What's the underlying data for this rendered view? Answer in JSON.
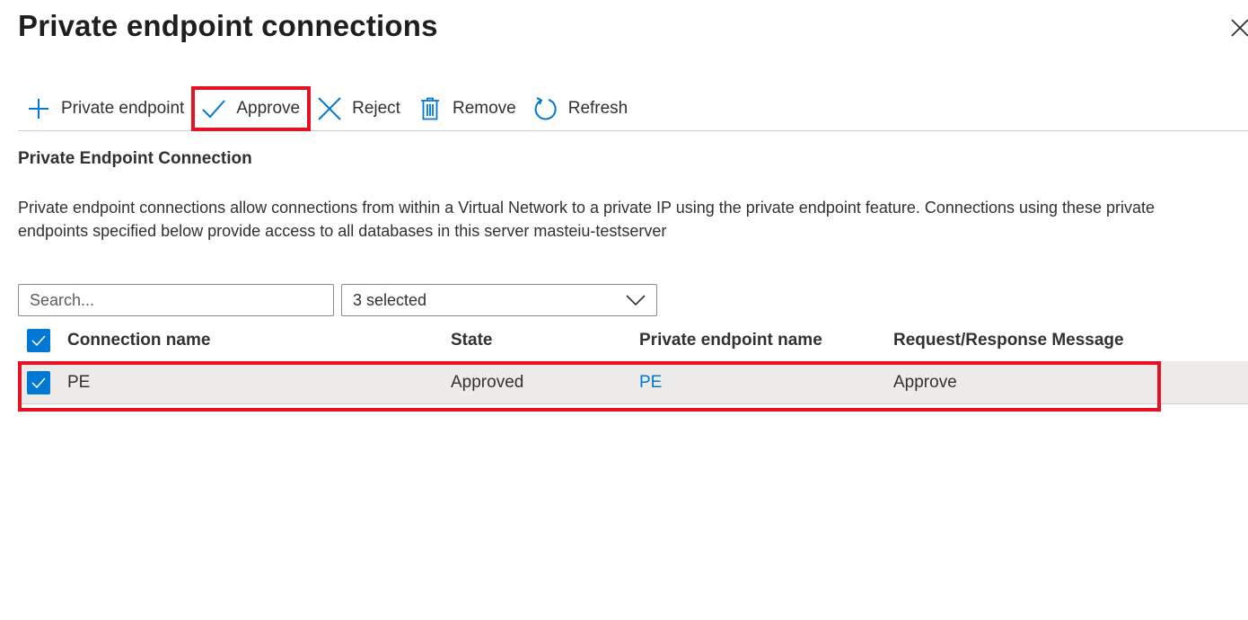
{
  "page": {
    "title": "Private endpoint connections",
    "close_icon": "close-icon"
  },
  "toolbar": {
    "items": [
      {
        "label": "Private endpoint",
        "icon": "plus-icon"
      },
      {
        "label": "Approve",
        "icon": "checkmark-icon",
        "highlighted": true
      },
      {
        "label": "Reject",
        "icon": "x-icon"
      },
      {
        "label": "Remove",
        "icon": "trash-icon"
      },
      {
        "label": "Refresh",
        "icon": "refresh-icon"
      }
    ]
  },
  "section": {
    "title": "Private Endpoint Connection",
    "description_line1": "Private endpoint connections allow connections from within a Virtual Network to a private IP using the private endpoint feature. Connections using these private",
    "description_line2": "endpoints specified below provide access to all databases in this server masteiu-testserver"
  },
  "filters": {
    "search_placeholder": "Search...",
    "search_value": "",
    "state_filter_value": "3 selected"
  },
  "table": {
    "columns": [
      "Connection name",
      "State",
      "Private endpoint name",
      "Request/Response Message"
    ],
    "header_checked": true,
    "rows": [
      {
        "checked": true,
        "connection_name": "PE",
        "state": "Approved",
        "private_endpoint_name": "PE",
        "message": "Approve",
        "highlighted": true
      }
    ]
  },
  "colors": {
    "accent": "#0078d4",
    "highlight_box": "#e81123",
    "selected_row": "#edebe9"
  }
}
